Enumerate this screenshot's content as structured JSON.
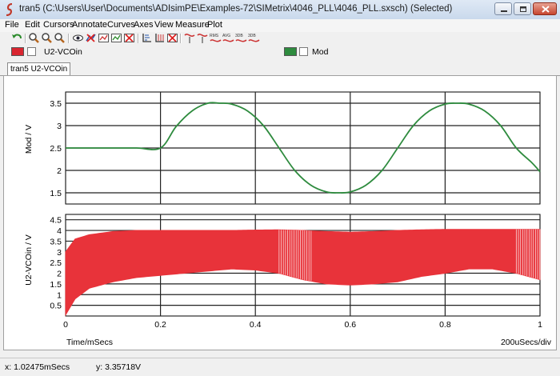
{
  "window": {
    "title": "tran5 (C:\\Users\\User\\Documents\\ADIsimPE\\Examples-72\\SIMetrix\\4046_PLL\\4046_PLL.sxsch) (Selected)"
  },
  "menu": [
    "File",
    "Edit",
    "Cursors",
    "Annotate",
    "Curves",
    "Axes",
    "View",
    "Measure",
    "Plot"
  ],
  "legend": [
    {
      "label": "U2-VCOin",
      "color": "#d9252f"
    },
    {
      "label": "Mod",
      "color": "#2e8b3e"
    }
  ],
  "tab_label": "tran5 U2-VCOin",
  "status": {
    "x": "x: 1.02475mSecs",
    "y": "y: 3.35718V"
  },
  "chart_data": [
    {
      "type": "line",
      "ylabel": "Mod / V",
      "xlim": [
        0,
        1
      ],
      "ylim": [
        1.25,
        3.75
      ],
      "yticks": [
        "1.5",
        "2",
        "2.5",
        "3",
        "3.5"
      ],
      "series": [
        {
          "name": "Mod",
          "color": "#2e8b3e",
          "x": [
            0,
            0.05,
            0.1,
            0.15,
            0.2,
            0.233,
            0.267,
            0.3,
            0.325,
            0.35,
            0.383,
            0.417,
            0.45,
            0.483,
            0.517,
            0.55,
            0.575,
            0.6,
            0.633,
            0.667,
            0.7,
            0.733,
            0.767,
            0.8,
            0.825,
            0.85,
            0.883,
            0.917,
            0.95,
            0.983,
            1.0
          ],
          "y": [
            2.5,
            2.5,
            2.5,
            2.5,
            2.5,
            2.98,
            3.33,
            3.5,
            3.5,
            3.48,
            3.33,
            3.0,
            2.5,
            2.0,
            1.67,
            1.52,
            1.5,
            1.52,
            1.67,
            2.0,
            2.5,
            3.0,
            3.33,
            3.48,
            3.5,
            3.48,
            3.33,
            3.0,
            2.5,
            2.17,
            1.97
          ]
        }
      ]
    },
    {
      "type": "area",
      "xlabel": "Time/mSecs",
      "x_scale_label": "200uSecs/div",
      "ylabel": "U2-VCOin / V",
      "xlim": [
        0,
        1
      ],
      "ylim": [
        0,
        4.75
      ],
      "xticks": [
        "0",
        "0.2",
        "0.4",
        "0.6",
        "0.8",
        "1"
      ],
      "yticks": [
        "0.5",
        "1",
        "1.5",
        "2",
        "2.5",
        "3",
        "3.5",
        "4",
        "4.5"
      ],
      "series": [
        {
          "name": "U2-VCOin",
          "color": "#e8333a",
          "x": [
            0,
            0.02,
            0.05,
            0.1,
            0.15,
            0.2,
            0.25,
            0.3,
            0.35,
            0.4,
            0.45,
            0.5,
            0.55,
            0.6,
            0.65,
            0.7,
            0.75,
            0.8,
            0.85,
            0.9,
            0.95,
            1.0
          ],
          "upper": [
            3.0,
            3.6,
            3.8,
            3.95,
            4.0,
            4.0,
            4.0,
            4.0,
            4.0,
            4.02,
            4.03,
            4.0,
            3.95,
            3.92,
            3.95,
            4.0,
            4.03,
            4.05,
            4.05,
            4.05,
            4.05,
            4.05
          ],
          "lower": [
            0.05,
            0.8,
            1.3,
            1.6,
            1.8,
            1.9,
            2.0,
            2.1,
            2.2,
            2.15,
            2.0,
            1.7,
            1.5,
            1.45,
            1.5,
            1.6,
            1.85,
            2.0,
            2.2,
            2.2,
            2.0,
            1.7
          ]
        }
      ]
    }
  ]
}
